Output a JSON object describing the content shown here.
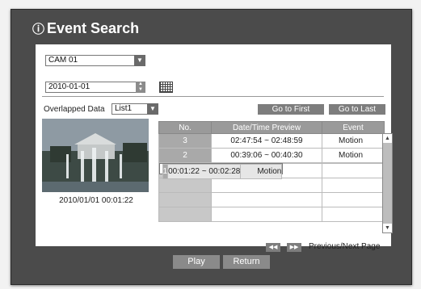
{
  "window": {
    "title": "Event Search",
    "title_icon": "info-icon"
  },
  "camera_select": {
    "value": "CAM 01"
  },
  "date_field": {
    "value": "2010-01-01"
  },
  "overlapped": {
    "label": "Overlapped Data",
    "value": "List1"
  },
  "nav_buttons": {
    "go_first": "Go to First",
    "go_last": "Go to Last"
  },
  "preview": {
    "timestamp": "2010/01/01  00:01:22"
  },
  "table": {
    "headers": [
      "No.",
      "Date/Time Preview",
      "Event"
    ],
    "rows": [
      {
        "no": "3",
        "time": "02:47:54 ~ 02:48:59",
        "event": "Motion"
      },
      {
        "no": "2",
        "time": "00:39:06 ~ 00:40:30",
        "event": "Motion"
      },
      {
        "no": "1",
        "time": "00:01:22 ~ 00:02:28",
        "event": "Motion"
      }
    ]
  },
  "pagination": {
    "label": "Previous/Next Page",
    "prev_icon": "rewind-icon",
    "next_icon": "fast-forward-icon"
  },
  "actions": {
    "play": "Play",
    "return": "Return"
  },
  "colors": {
    "frame": "#4b4b4b",
    "button": "#7d7d7d",
    "header": "#9a9a9a"
  }
}
